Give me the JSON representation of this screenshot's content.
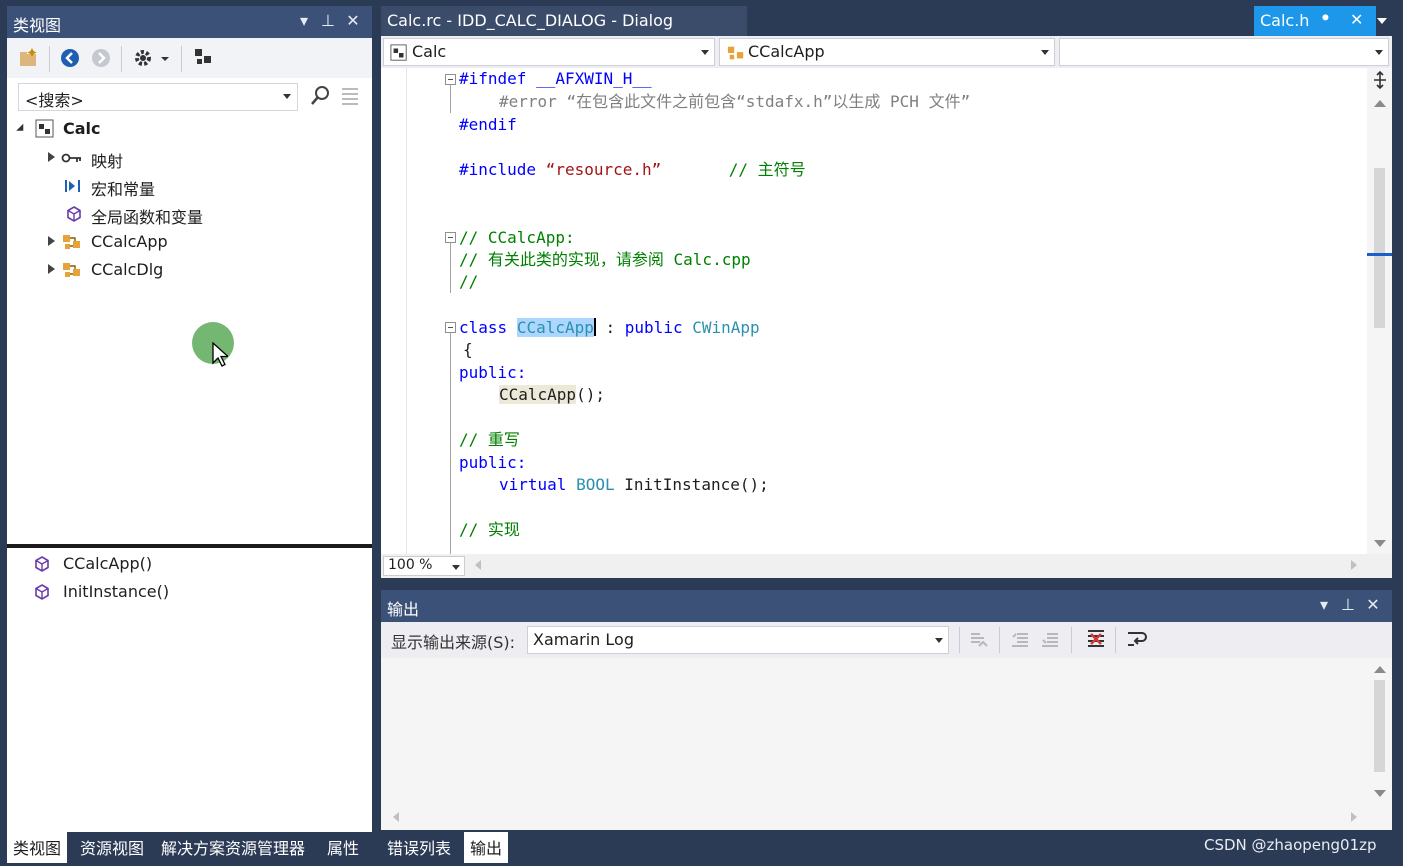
{
  "left_panel": {
    "title": "类视图",
    "search": {
      "value": "<搜索>"
    },
    "tree": {
      "root": "Calc",
      "items": [
        "映射",
        "宏和常量",
        "全局函数和变量",
        "CCalcApp",
        "CCalcDlg"
      ]
    },
    "members": [
      "CCalcApp()",
      "InitInstance()"
    ],
    "bottom_tabs": [
      "类视图",
      "资源视图",
      "解决方案资源管理器",
      "属性"
    ]
  },
  "editor": {
    "tabs": [
      {
        "label": "Calc.rc - IDD_CALC_DIALOG - Dialog"
      },
      {
        "label": "Calc.h"
      }
    ],
    "nav": {
      "project": "Calc",
      "class": "CCalcApp",
      "member": ""
    },
    "zoom": "100 %",
    "code": {
      "l1": "#ifndef __AFXWIN_H__",
      "l2_a": "#error",
      "l2_b": "“在包含此文件之前包含“stdafx.h”以生成 PCH 文件”",
      "l3": "#endif",
      "l4_a": "#include",
      "l4_b": "“resource.h”",
      "l4_c": "// 主符号",
      "l5": "// CCalcApp:",
      "l6": "// 有关此类的实现，请参阅 Calc.cpp",
      "l7": "//",
      "l8_kw": "class",
      "l8_cls": "CCalcApp",
      "l8_mid": " : ",
      "l8_pub": "public",
      "l8_base": "CWinApp",
      "l9": "{",
      "l10": "public:",
      "l11_a": "CCalcApp",
      "l11_b": "();",
      "l12": "// 重写",
      "l13": "public:",
      "l14_a": "virtual",
      "l14_b": "BOOL",
      "l14_c": "InitInstance();",
      "l15": "// 实现"
    }
  },
  "output": {
    "title": "输出",
    "source_label": "显示输出来源(S):",
    "source_value": "Xamarin Log",
    "bottom_tabs": [
      "错误列表",
      "输出"
    ]
  },
  "watermark": "CSDN @zhaopeng01zp"
}
